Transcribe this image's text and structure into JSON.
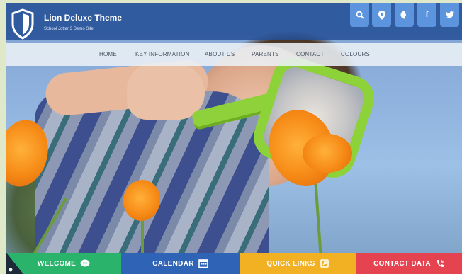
{
  "site": {
    "title": "Lion Deluxe Theme",
    "subtitle": "School Jotter 3 Demo Site"
  },
  "social": [
    {
      "icon": "search-icon",
      "glyph": "⚲"
    },
    {
      "icon": "map-pin-icon",
      "glyph": "⚲"
    },
    {
      "icon": "translate-icon",
      "glyph": "◑"
    },
    {
      "icon": "facebook-icon",
      "glyph": "f"
    },
    {
      "icon": "twitter-icon",
      "glyph": "🐦"
    }
  ],
  "nav": {
    "home": "HOME",
    "key_information": "KEY INFORMATION",
    "about_us": "ABOUT US",
    "parents": "PARENTS",
    "contact": "CONTACT",
    "colours": "COLOURS"
  },
  "tiles": {
    "welcome": {
      "label": "WELCOME",
      "color": "#2ab36a",
      "icon": "chat-icon"
    },
    "calendar": {
      "label": "CALENDAR",
      "color": "#2f63b6",
      "icon": "calendar-icon"
    },
    "quick_links": {
      "label": "QUICK LINKS",
      "color": "#f2b023",
      "icon": "external-link-icon"
    },
    "contact_data": {
      "label": "CONTACT DATA",
      "color": "#e5434f",
      "icon": "phone-icon"
    }
  },
  "colors": {
    "header": "#244f96",
    "social_button": "#5c95dd",
    "nav_bg": "#ecf1f6"
  }
}
